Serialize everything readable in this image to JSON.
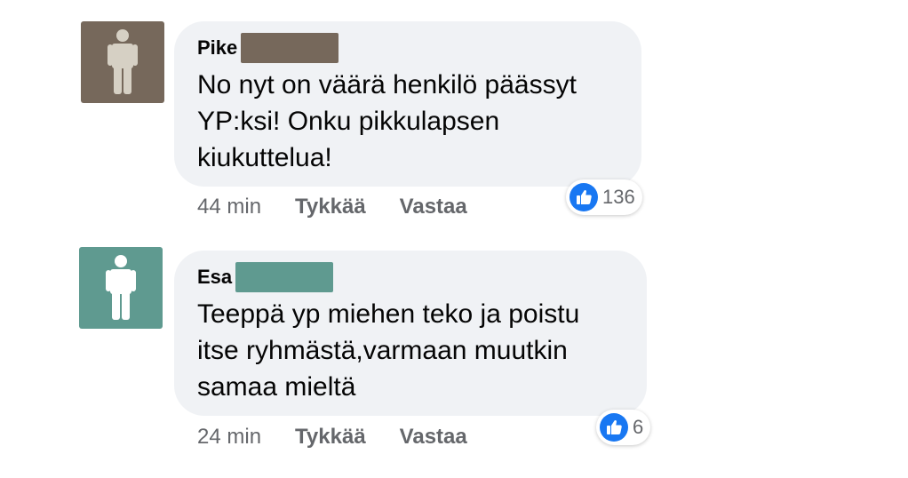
{
  "comments": [
    {
      "author": "Pike",
      "avatar_color": "#76685b",
      "redaction_color": "#76685b",
      "text_lines": [
        "No nyt on väärä henkilö päässyt",
        "YP:ksi! Onku pikkulapsen",
        "kiukuttelua!"
      ],
      "time": "44 min",
      "like_label": "Tykkää",
      "reply_label": "Vastaa",
      "reaction_count": "136"
    },
    {
      "author": "Esa",
      "avatar_color": "#5f9a90",
      "redaction_color": "#5f9a90",
      "text_lines": [
        "Teeppä yp miehen teko ja poistu",
        "itse ryhmästä,varmaan muutkin",
        "samaa mieltä"
      ],
      "time": "24 min",
      "like_label": "Tykkää",
      "reply_label": "Vastaa",
      "reaction_count": "6"
    }
  ],
  "icons": {
    "avatar": "person-silhouette-icon",
    "reaction": "thumbs-up-icon"
  },
  "colors": {
    "bubble": "#f0f2f5",
    "like_blue": "#1877f2",
    "meta_text": "#65676b"
  }
}
